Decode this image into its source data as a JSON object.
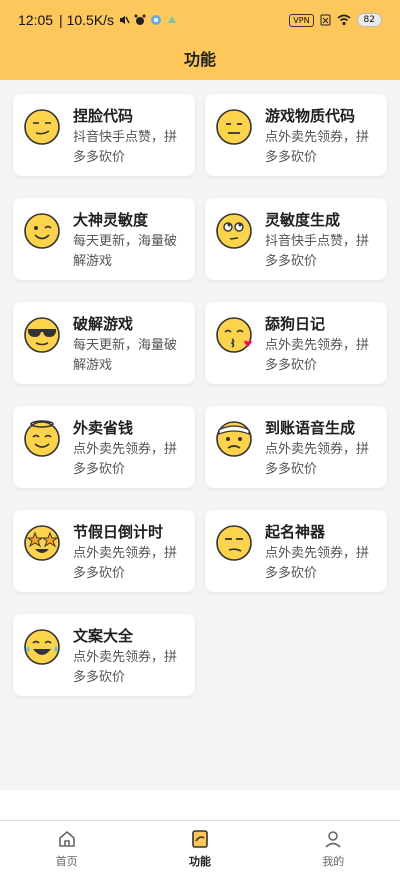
{
  "status_bar": {
    "time": "12:05",
    "network_speed": "| 10.5K/s",
    "vpn_label": "VPN",
    "battery": "82"
  },
  "header": {
    "title": "功能"
  },
  "cards": [
    {
      "title": "捏脸代码",
      "desc": "抖音快手点赞，拼多多砍价",
      "icon": "smirk-face-icon"
    },
    {
      "title": "游戏物质代码",
      "desc": "点外卖先领券，拼多多砍价",
      "icon": "neutral-face-icon"
    },
    {
      "title": "大神灵敏度",
      "desc": "每天更新，海量破解游戏",
      "icon": "wink-face-icon"
    },
    {
      "title": "灵敏度生成",
      "desc": "抖音快手点赞，拼多多砍价",
      "icon": "eye-roll-face-icon"
    },
    {
      "title": "破解游戏",
      "desc": "每天更新，海量破解游戏",
      "icon": "sunglasses-face-icon"
    },
    {
      "title": "舔狗日记",
      "desc": "点外卖先领券，拼多多砍价",
      "icon": "kiss-heart-face-icon"
    },
    {
      "title": "外卖省钱",
      "desc": "点外卖先领券，拼多多砍价",
      "icon": "halo-face-icon"
    },
    {
      "title": "到账语音生成",
      "desc": "点外卖先领券，拼多多砍价",
      "icon": "bandage-face-icon"
    },
    {
      "title": "节假日倒计时",
      "desc": "点外卖先领券，拼多多砍价",
      "icon": "star-eyes-face-icon"
    },
    {
      "title": "起名神器",
      "desc": "点外卖先领券，拼多多砍价",
      "icon": "unamused-face-icon"
    },
    {
      "title": "文案大全",
      "desc": "点外卖先领券，拼多多砍价",
      "icon": "laugh-tears-face-icon"
    }
  ],
  "nav": {
    "home": "首页",
    "features": "功能",
    "mine": "我的"
  }
}
